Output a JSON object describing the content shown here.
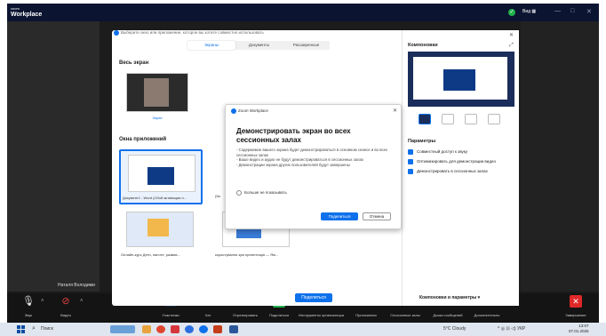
{
  "app": {
    "logo_small": "zoom",
    "logo_big": "Workplace",
    "view_label": "Вид"
  },
  "share_dialog": {
    "title": "Выберите окно или приложение, которое вы хотите совместно использовать",
    "tabs": [
      {
        "label": "Экраны",
        "active": true
      },
      {
        "label": "Документы",
        "active": false
      },
      {
        "label": "Расширенные",
        "active": false
      }
    ],
    "whole_screen_section": "Весь экран",
    "screen_thumb_label": "Экран",
    "app_windows_section": "Окна приложений",
    "windows": [
      {
        "caption": "Документ1 - Word (Сбой активации п..."
      },
      {
        "caption": "(ба"
      },
      {
        "caption": "Онлайн-курс Дети, нанчте, развив..."
      },
      {
        "caption": "корастування зум презентація — Яю..."
      }
    ],
    "layouts_header": "Компоновки",
    "params_header": "Параметры",
    "params": [
      {
        "label": "Совместный доступ к звуку",
        "checked": true
      },
      {
        "label": "Оптимизировать для демонстрации видео",
        "checked": true
      },
      {
        "label": "Демонстрировать в сессионных залах",
        "checked": true
      }
    ],
    "share_button": "Поделиться",
    "layouts_params_button": "Компоновки и параметры"
  },
  "modal": {
    "app_name": "Zoom Workplace",
    "title": "Демонстрировать экран во всех сессионных залах",
    "body_lines": [
      "- Содержимое вашего экрана будет демонстрироваться в основном сеансе и во всех сессионных залах",
      "- Ваше видео и аудио не будут демонстрироваться в сессионных залах",
      "- Демонстрации экрана других пользователей будут завершены"
    ],
    "checkbox_label": "Больше не показывать",
    "share_button": "Поделиться",
    "cancel_button": "Отмена"
  },
  "participant_name": "Наталя Володими",
  "toolbar": {
    "items": [
      {
        "label": "Звук",
        "icon": "microphone-icon"
      },
      {
        "label": "Видео",
        "icon": "video-off-icon"
      },
      {
        "label": "Участники",
        "icon": "participants-icon",
        "count": "1"
      },
      {
        "label": "Чат",
        "icon": "chat-icon"
      },
      {
        "label": "Отреагировать",
        "icon": "reaction-icon"
      },
      {
        "label": "Поделиться",
        "icon": "share-icon"
      },
      {
        "label": "Инструменты организатора",
        "icon": "shield-icon"
      },
      {
        "label": "Приложения",
        "icon": "apps-icon"
      },
      {
        "label": "Сессионные залы",
        "icon": "breakout-icon"
      },
      {
        "label": "Доски сообщений",
        "icon": "whiteboard-icon"
      },
      {
        "label": "Дополнительно",
        "icon": "more-icon"
      },
      {
        "label": "Завершение",
        "icon": "end-icon"
      }
    ]
  },
  "taskbar": {
    "search_label": "Поиск",
    "weather": "5°C Cloudy",
    "lang": "УКР",
    "time": "13:07",
    "date": "07.01.2025"
  },
  "colors": {
    "accent": "#0e71eb",
    "titlebar": "#0b1431",
    "end_red": "#e02828"
  }
}
